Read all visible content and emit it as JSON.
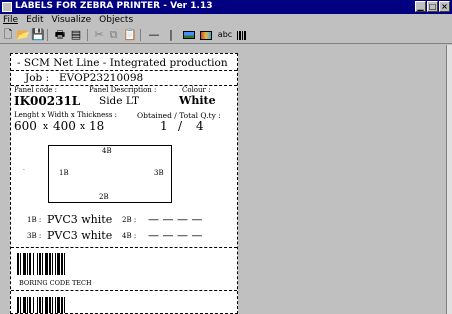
{
  "window": {
    "title": "LABELS FOR ZEBRA PRINTER - Ver 1.13",
    "minimize_icon": "minimize-icon",
    "maximize_icon": "maximize-icon",
    "close_icon": "close-icon"
  },
  "menu": [
    "File",
    "Edit",
    "Visualize",
    "Objects"
  ],
  "toolbar": {
    "text_tool_label": "abc",
    "icons": [
      "new-document-icon",
      "open-folder-icon",
      "save-icon",
      "print-icon",
      "print-preview-icon",
      "cut-icon",
      "copy-icon",
      "paste-icon",
      "line-tool-icon",
      "vertical-line-icon",
      "image-icon",
      "picture-icon",
      "text-icon",
      "barcode-tool-icon"
    ]
  },
  "label": {
    "header": "- SCM Net Line - Integrated production",
    "job_label": "Job :",
    "job_value": "EVOP23210098",
    "panel_code_label": "Panel code :",
    "panel_code_value": "IK00231L",
    "description_label": "Panel Description :",
    "description_value": "Side LT",
    "colour_label": "Colour :",
    "colour_value": "White",
    "dimensions_label": "Lenght x Width x Thickness :",
    "length": "600",
    "width": "400",
    "thickness": "18",
    "times_sign": "x",
    "quantity_label": "Obtained / Total Q.ty :",
    "obtained": "1",
    "quantity_separator": "/",
    "total": "4",
    "diagram": {
      "top": "4B",
      "left": "1B",
      "right": "3B",
      "bottom": "2B"
    },
    "edges": [
      {
        "label": "1B :",
        "value": "PVC3 white"
      },
      {
        "label": "2B :",
        "value": "— —  — —"
      },
      {
        "label": "3B :",
        "value": "PVC3 white"
      },
      {
        "label": "4B :",
        "value": "— —  — —"
      }
    ],
    "barcode_caption": "BORING CODE TECH"
  }
}
